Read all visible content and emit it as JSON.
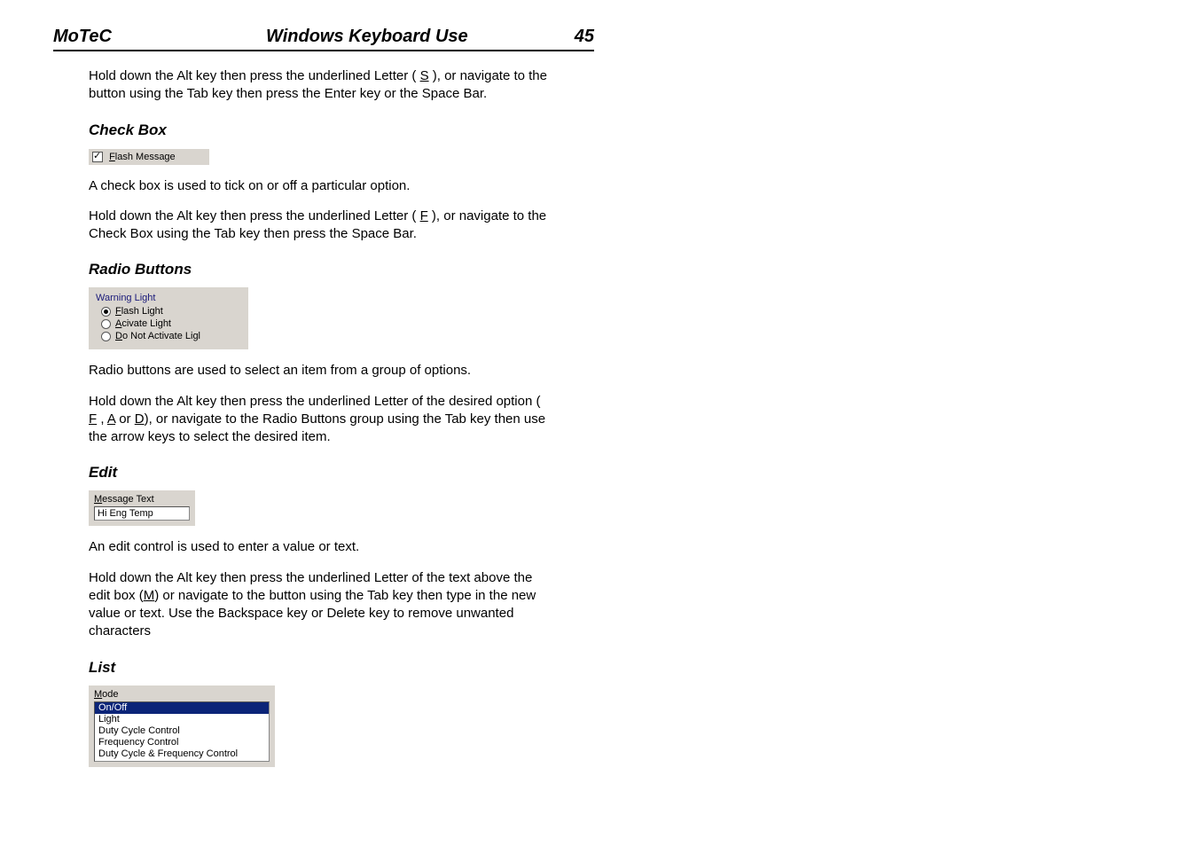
{
  "header": {
    "brand": "MoTeC",
    "title": "Windows Keyboard Use",
    "page_number": "45"
  },
  "intro_text_pre": "Hold down the Alt key then press the underlined Letter ( ",
  "intro_letter": "S",
  "intro_text_post": " ), or navigate to the button using the Tab key then press the Enter key or the Space Bar.",
  "checkbox": {
    "heading": "Check Box",
    "ui_label_letter": "F",
    "ui_label_rest": "lash Message",
    "desc": "A check box is used to tick on or off a particular option.",
    "howto_pre": "Hold down the Alt key then press the underlined Letter ( ",
    "howto_letter": "F",
    "howto_post": " ), or navigate to the Check Box using the Tab key then press the Space Bar."
  },
  "radio": {
    "heading": "Radio Buttons",
    "group_title": "Warning Light",
    "options": [
      {
        "letter": "F",
        "rest": "lash Light",
        "selected": true
      },
      {
        "letter": "A",
        "rest": "civate Light",
        "selected": false
      },
      {
        "letter": "D",
        "rest": "o Not Activate Ligl",
        "selected": false
      }
    ],
    "desc": "Radio buttons are used to select an item from a group of options.",
    "howto_pre": "Hold down the Alt key then press the underlined Letter of the desired option ( ",
    "howto_l1": "F",
    "howto_sep1": " , ",
    "howto_l2": "A",
    "howto_sep2": " or ",
    "howto_l3": "D",
    "howto_post": "), or navigate to the Radio Buttons group using the Tab key then use the arrow keys to select the desired item."
  },
  "edit": {
    "heading": "Edit",
    "label_letter": "M",
    "label_rest": "essage Text",
    "value": "Hi Eng Temp",
    "desc": "An edit control is used to enter a value or text.",
    "howto_pre": "Hold down the Alt key then press the underlined Letter of the text above the edit box (",
    "howto_letter": "M",
    "howto_post": ") or navigate to the button using the Tab key then type in the new value or text. Use the Backspace key or Delete key to remove unwanted characters"
  },
  "list": {
    "heading": "List",
    "label_letter": "M",
    "label_rest": "ode",
    "items": [
      {
        "text": "On/Off",
        "selected": true
      },
      {
        "text": "Light",
        "selected": false
      },
      {
        "text": "Duty Cycle Control",
        "selected": false
      },
      {
        "text": "Frequency Control",
        "selected": false
      },
      {
        "text": "Duty Cycle & Frequency Control",
        "selected": false
      }
    ]
  }
}
